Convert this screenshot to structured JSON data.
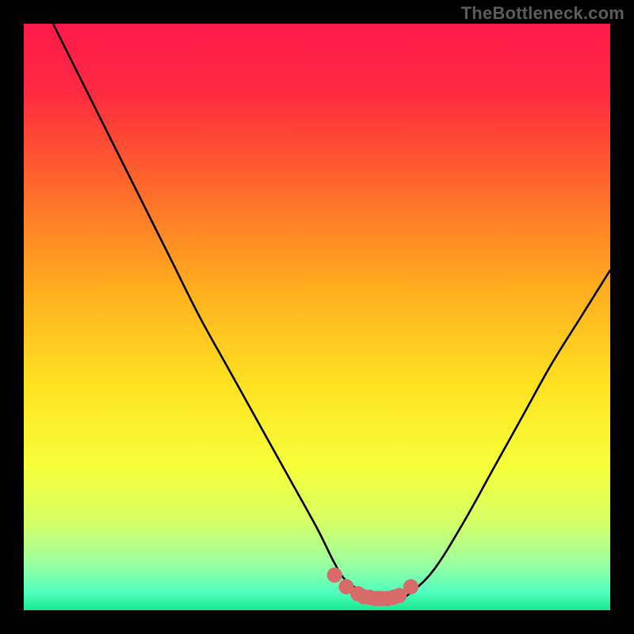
{
  "watermark": "TheBottleneck.com",
  "colors": {
    "black": "#000000",
    "curve": "#000000",
    "marker": "#d96a6a",
    "gradient_stops": [
      {
        "offset": 0.0,
        "color": "#ff184a"
      },
      {
        "offset": 0.12,
        "color": "#ff2b3f"
      },
      {
        "offset": 0.28,
        "color": "#ff6a2a"
      },
      {
        "offset": 0.45,
        "color": "#ffad1e"
      },
      {
        "offset": 0.62,
        "color": "#ffe321"
      },
      {
        "offset": 0.76,
        "color": "#f5ff3a"
      },
      {
        "offset": 0.85,
        "color": "#d4ff66"
      },
      {
        "offset": 0.92,
        "color": "#9cffa0"
      },
      {
        "offset": 0.97,
        "color": "#4effc0"
      },
      {
        "offset": 1.0,
        "color": "#17e88c"
      }
    ]
  },
  "chart_data": {
    "type": "line",
    "title": "",
    "xlabel": "",
    "ylabel": "",
    "xlim": [
      0,
      100
    ],
    "ylim": [
      0,
      100
    ],
    "series": [
      {
        "name": "bottleneck-curve",
        "x": [
          5,
          10,
          15,
          20,
          25,
          30,
          35,
          40,
          45,
          50,
          53,
          55,
          58,
          60,
          62,
          64,
          66,
          70,
          75,
          80,
          85,
          90,
          95,
          100
        ],
        "values": [
          100,
          90,
          80,
          70,
          60,
          50,
          41,
          32,
          23,
          14,
          8,
          5,
          3,
          2,
          2,
          2,
          3,
          7,
          15,
          24,
          33,
          42,
          50,
          58
        ]
      }
    ],
    "markers": {
      "name": "bottom-markers",
      "x": [
        53,
        55,
        57,
        58,
        59,
        60,
        61,
        62,
        63,
        64,
        66
      ],
      "values": [
        6.0,
        4.0,
        2.8,
        2.3,
        2.2,
        2.0,
        2.0,
        2.0,
        2.2,
        2.5,
        4.0
      ],
      "radius": 1.3
    }
  }
}
